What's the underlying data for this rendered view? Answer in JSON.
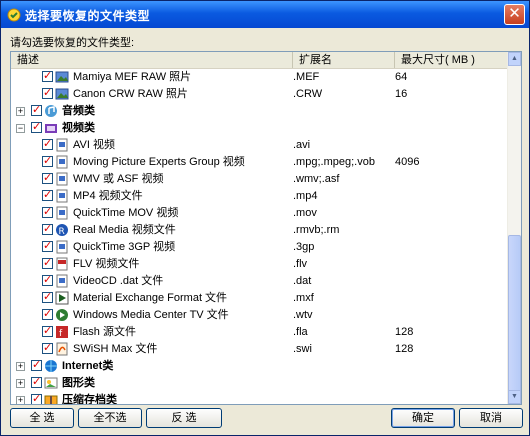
{
  "window": {
    "title": "选择要恢复的文件类型",
    "close_label": "✕"
  },
  "prompt": "请勾选要恢复的文件类型:",
  "columns": {
    "desc": "描述",
    "ext": "扩展名",
    "max": "最大尺寸( MB )"
  },
  "rows": [
    {
      "level": 1,
      "name": "Mamiya MEF RAW 照片",
      "ext": ".MEF",
      "size": "64",
      "icon": "image-icon"
    },
    {
      "level": 1,
      "name": "Canon CRW RAW 照片",
      "ext": ".CRW",
      "size": "16",
      "icon": "image-icon"
    },
    {
      "level": 0,
      "name": "音频类",
      "ext": "",
      "size": "",
      "icon": "audio-folder-icon",
      "expander": "+"
    },
    {
      "level": 0,
      "name": "视频类",
      "ext": "",
      "size": "",
      "icon": "video-folder-icon",
      "expander": "−"
    },
    {
      "level": 1,
      "name": "AVI 视频",
      "ext": ".avi",
      "size": "",
      "icon": "video-file-icon"
    },
    {
      "level": 1,
      "name": "Moving Picture Experts Group 视频",
      "ext": ".mpg;.mpeg;.vob",
      "size": "4096",
      "icon": "video-file-icon"
    },
    {
      "level": 1,
      "name": "WMV 或 ASF 视频",
      "ext": ".wmv;.asf",
      "size": "",
      "icon": "video-file-icon"
    },
    {
      "level": 1,
      "name": "MP4 视频文件",
      "ext": ".mp4",
      "size": "",
      "icon": "video-file-icon"
    },
    {
      "level": 1,
      "name": "QuickTime MOV 视频",
      "ext": ".mov",
      "size": "",
      "icon": "video-file-icon"
    },
    {
      "level": 1,
      "name": "Real Media 视频文件",
      "ext": ".rmvb;.rm",
      "size": "",
      "icon": "realmedia-icon"
    },
    {
      "level": 1,
      "name": "QuickTime 3GP 视频",
      "ext": ".3gp",
      "size": "",
      "icon": "video-file-icon"
    },
    {
      "level": 1,
      "name": "FLV 视频文件",
      "ext": ".flv",
      "size": "",
      "icon": "flv-icon"
    },
    {
      "level": 1,
      "name": "VideoCD .dat 文件",
      "ext": ".dat",
      "size": "",
      "icon": "video-file-icon"
    },
    {
      "level": 1,
      "name": "Material Exchange Format 文件",
      "ext": ".mxf",
      "size": "",
      "icon": "play-icon"
    },
    {
      "level": 1,
      "name": "Windows Media Center TV 文件",
      "ext": ".wtv",
      "size": "",
      "icon": "media-center-icon"
    },
    {
      "level": 1,
      "name": "Flash 源文件",
      "ext": ".fla",
      "size": "128",
      "icon": "flash-icon"
    },
    {
      "level": 1,
      "name": "SWiSH Max 文件",
      "ext": ".swi",
      "size": "128",
      "icon": "swish-icon"
    },
    {
      "level": 0,
      "name": "Internet类",
      "ext": "",
      "size": "",
      "icon": "internet-folder-icon",
      "expander": "+"
    },
    {
      "level": 0,
      "name": "图形类",
      "ext": "",
      "size": "",
      "icon": "graphics-folder-icon",
      "expander": "+"
    },
    {
      "level": 0,
      "name": "压缩存档类",
      "ext": "",
      "size": "",
      "icon": "archive-folder-icon",
      "expander": "+"
    }
  ],
  "buttons": {
    "select_all": "全 选",
    "select_none": "全不选",
    "invert": "反 选",
    "ok": "确定",
    "cancel": "取消"
  },
  "check_mark": "✓"
}
